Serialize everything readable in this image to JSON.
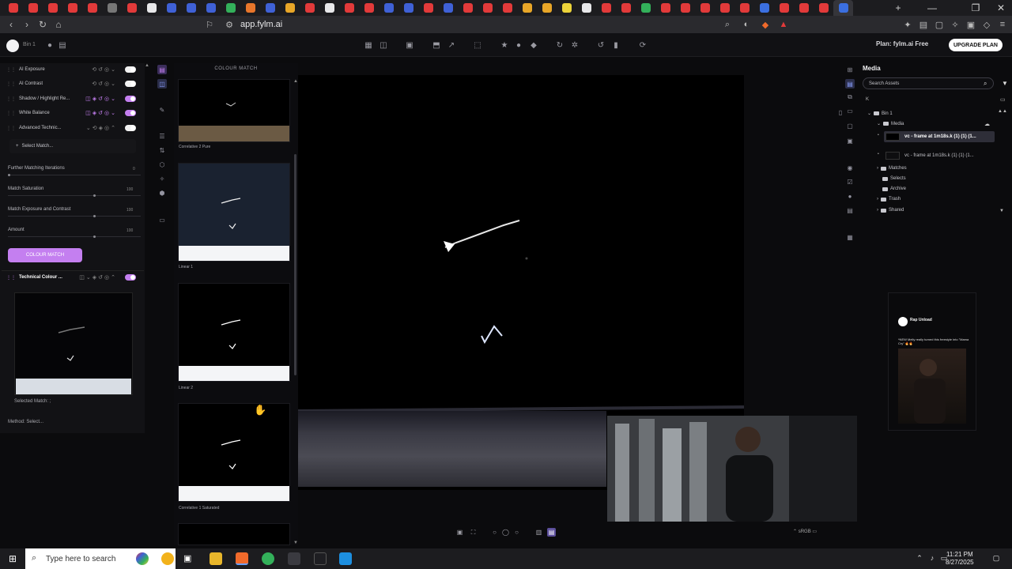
{
  "browser": {
    "url": "app.fylm.ai",
    "tab_colors": [
      "#e23a3a",
      "#e23a3a",
      "#e23a3a",
      "#e23a3a",
      "#e23a3a",
      "#777",
      "#e23a3a",
      "#e8e8ea",
      "#3f61d6",
      "#3f61d6",
      "#3f61d6",
      "#33b05a",
      "#e8762b",
      "#3f61d6",
      "#e8a628",
      "#e23a3a",
      "#e8e8ea",
      "#e23a3a",
      "#e23a3a",
      "#3f61d6",
      "#3f61d6",
      "#e23a3a",
      "#3f61d6",
      "#e23a3a",
      "#e23a3a",
      "#e23a3a",
      "#e8a628",
      "#e8a628",
      "#ecd33a",
      "#e8e8ea",
      "#e23a3a",
      "#e23a3a",
      "#33b05a",
      "#e23a3a",
      "#e23a3a",
      "#e23a3a",
      "#e23a3a",
      "#e23a3a",
      "#3b6fe0",
      "#e23a3a",
      "#e23a3a",
      "#e23a3a",
      "#3b6fe0"
    ],
    "new_tab": "+",
    "window_controls": {
      "minimize": "—",
      "restore": "❐",
      "close": "✕"
    }
  },
  "app": {
    "project": "Bin 1",
    "plan_label": "Plan: fylm.ai Free",
    "upgrade_label": "UPGRADE PLAN"
  },
  "left": {
    "layers": [
      {
        "label": "AI Exposure",
        "toggle": "off"
      },
      {
        "label": "AI Contrast",
        "toggle": "off"
      },
      {
        "label": "Shadow / Highlight Re...",
        "toggle": "on"
      },
      {
        "label": "White Balance",
        "toggle": "on"
      },
      {
        "label": "Advanced Technic...",
        "toggle": "off"
      }
    ],
    "select_match": "Select Match...",
    "sliders": [
      {
        "label": "Further Matching Iterations",
        "value": "0"
      },
      {
        "label": "Match Saturation",
        "value": "100"
      },
      {
        "label": "Match Exposure and Contrast",
        "value": "100"
      },
      {
        "label": "Amount",
        "value": "100"
      }
    ],
    "colour_match_button": "COLOUR MATCH",
    "technical_layer": "Technical Colour ...",
    "selected_match": "Selected Match: ;",
    "method": "Method: Select..."
  },
  "gallery": {
    "title": "COLOUR MATCH",
    "items": [
      {
        "label": "Correlative 2 Pure"
      },
      {
        "label": "Linear 1"
      },
      {
        "label": "Linear 2"
      },
      {
        "label": "Correlative 1 Saturated"
      }
    ]
  },
  "viewer": {
    "colorspace": "sRGB"
  },
  "media": {
    "title": "Media",
    "search_placeholder": "Search Assets",
    "k_label": "K",
    "bin": "Bin 1",
    "folder_media": "Media",
    "items": [
      {
        "label": "vc - frame at 1m18s.k (1) (1) (1..."
      },
      {
        "label": "vc - frame at 1m18s.k (1) (1) (1..."
      }
    ],
    "folders": [
      "Matches",
      "Selects",
      "Archive",
      "Trash",
      "Shared"
    ]
  },
  "social": {
    "account": "Rap Unload",
    "caption": "*NEW Melly really turned this freestyle into \"Mama Cry\" 🔥🔥"
  },
  "taskbar": {
    "search_placeholder": "Type here to search",
    "time": "11:21 PM",
    "date": "8/27/2025"
  }
}
